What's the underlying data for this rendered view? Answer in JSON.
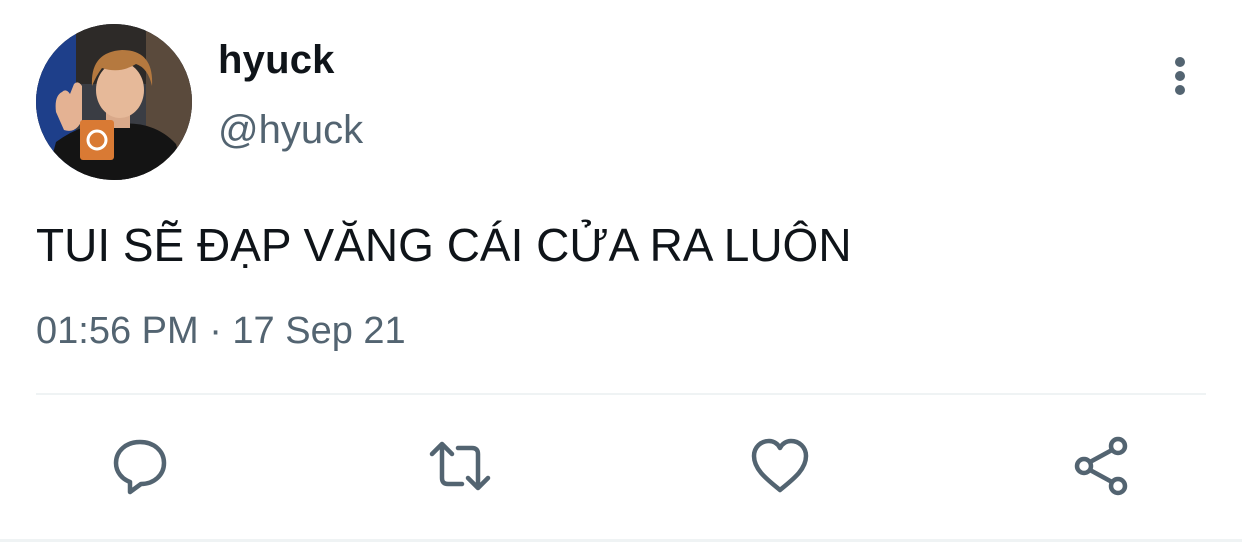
{
  "tweet": {
    "author": {
      "display_name": "hyuck",
      "handle": "@hyuck"
    },
    "text": "TUI SẼ ĐẠP VĂNG CÁI CỬA RA LUÔN",
    "timestamp": "01:56 PM · 17 Sep 21"
  },
  "icons": {
    "more": "more-vertical-icon",
    "reply": "reply-icon",
    "retweet": "retweet-icon",
    "like": "heart-icon",
    "share": "share-icon"
  },
  "colors": {
    "text_primary": "#0f1419",
    "text_secondary": "#536471",
    "icon_gray": "#536471",
    "divider": "#eff3f4"
  }
}
